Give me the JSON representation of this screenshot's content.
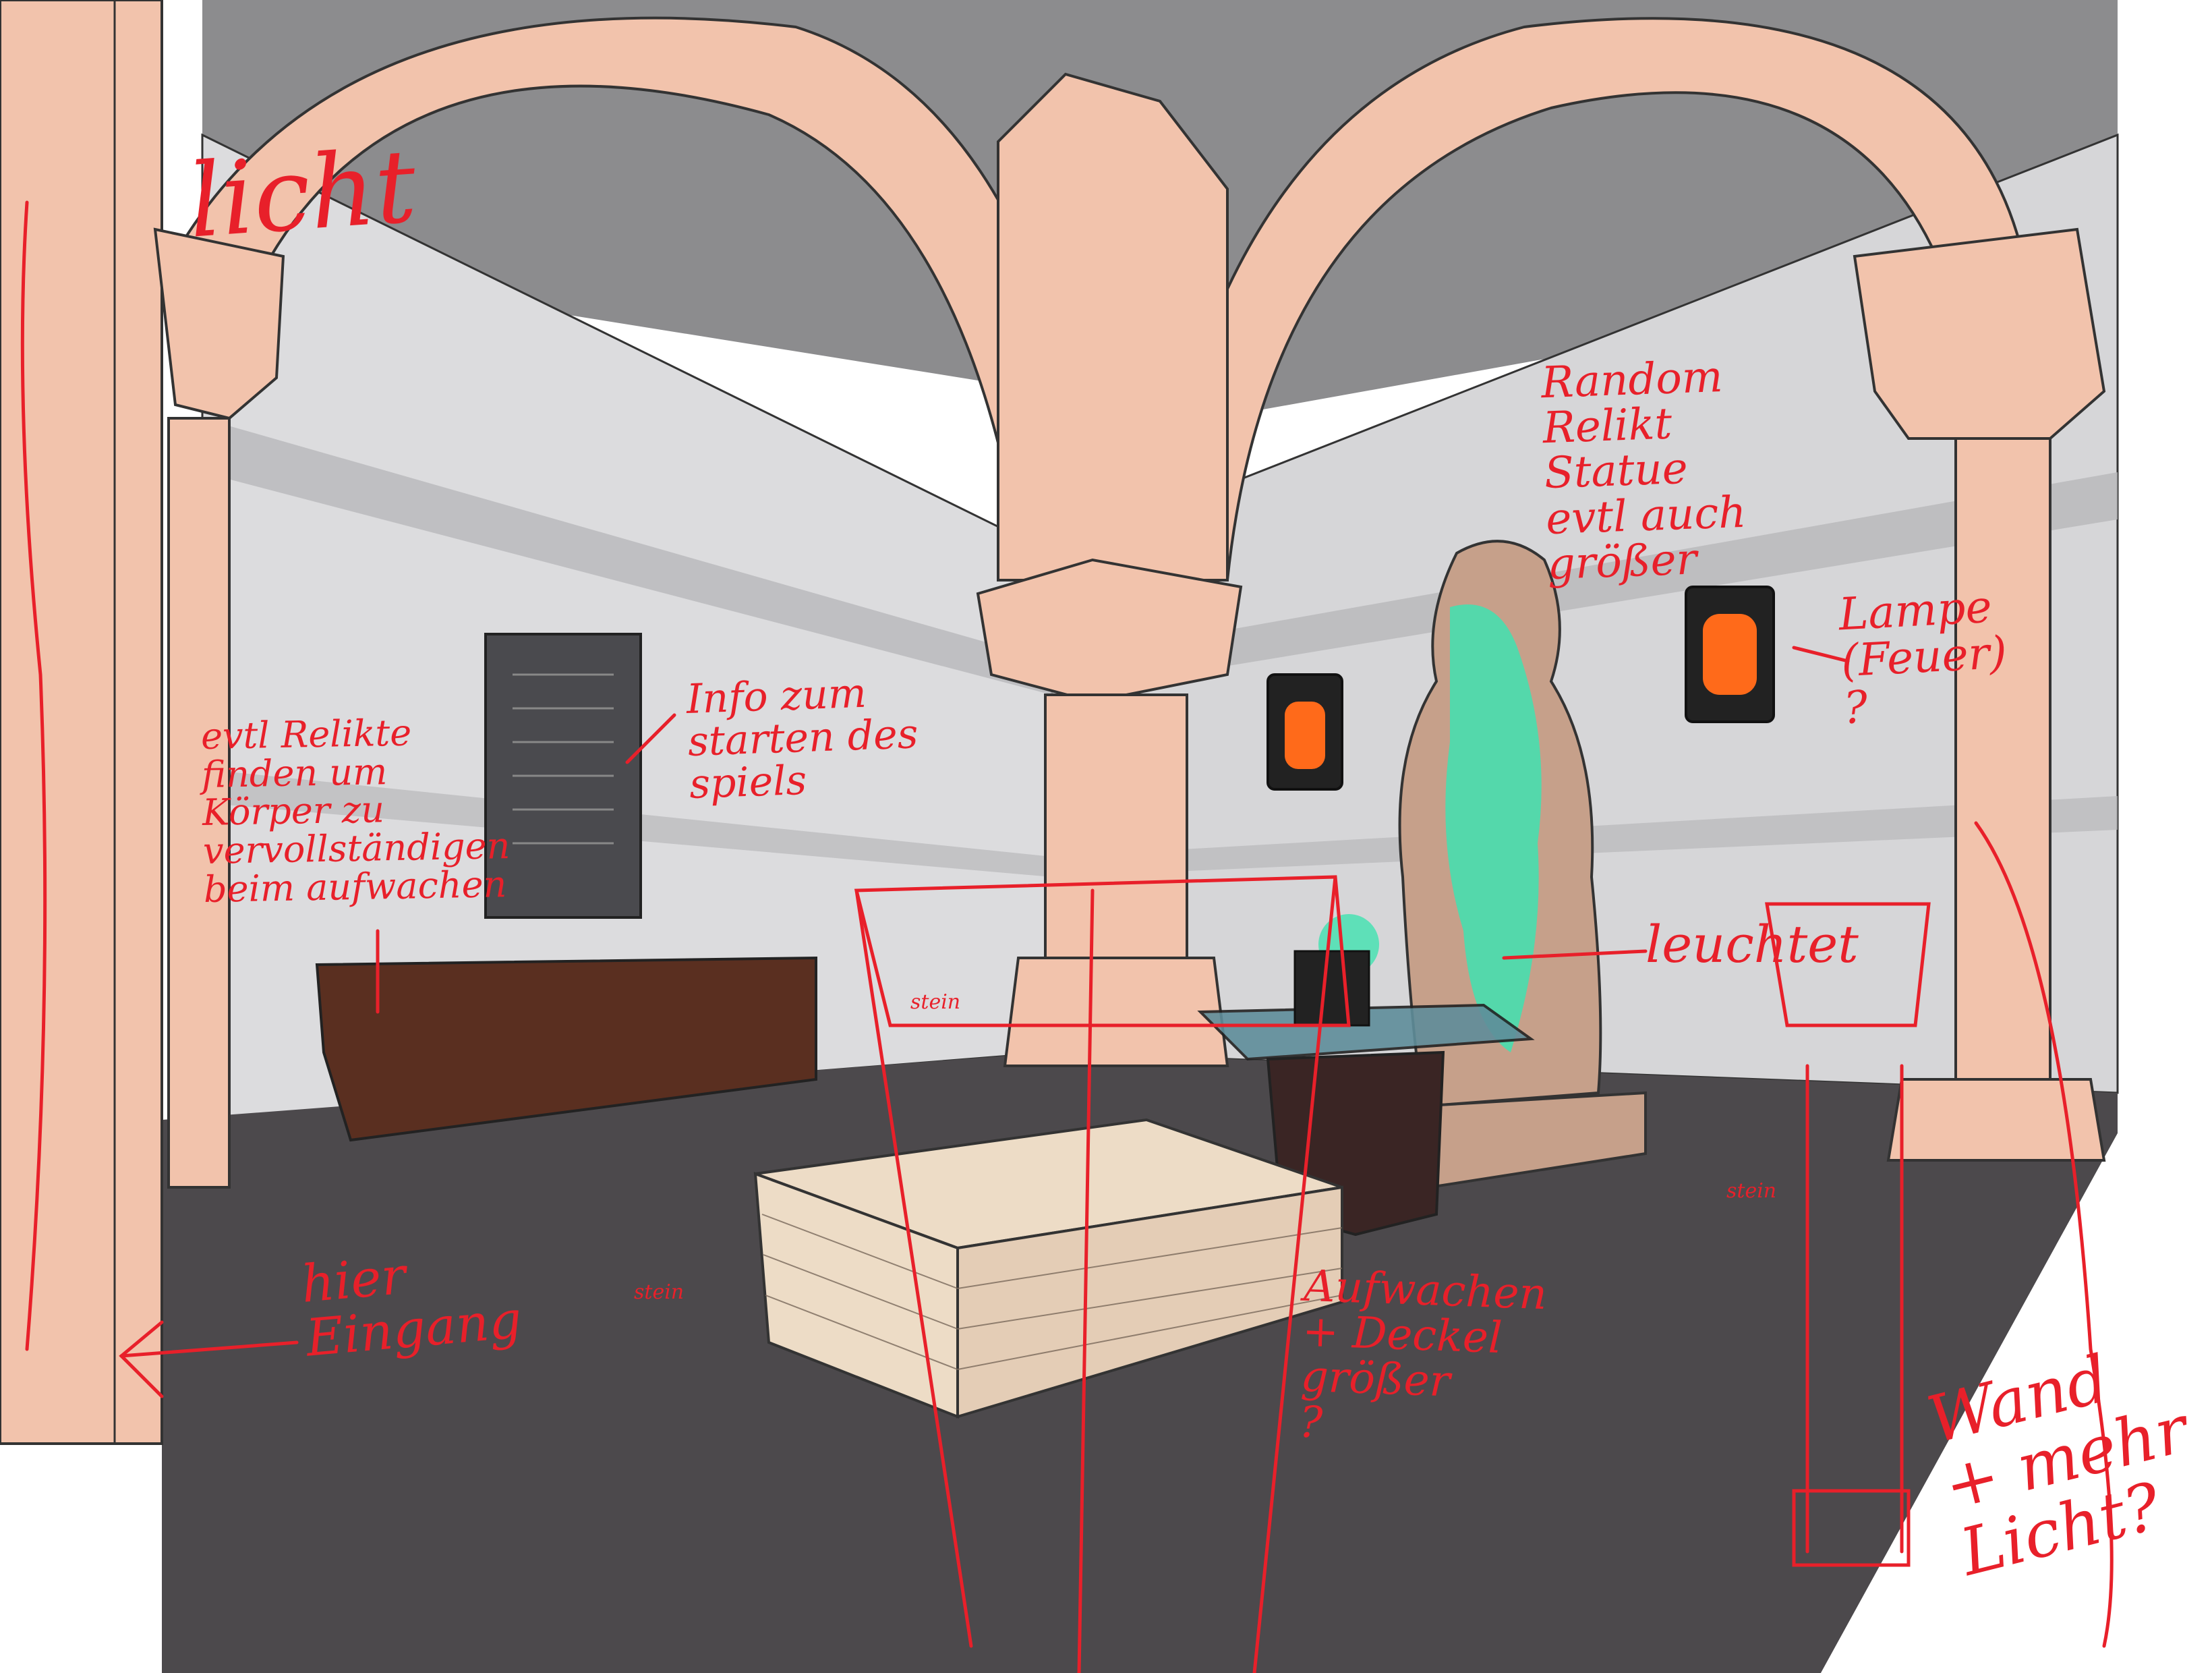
{
  "notes": {
    "licht": "licht",
    "info": [
      "Info zum",
      "starten des",
      "spiels"
    ],
    "relikte": [
      "evtl Relikte",
      "finden um",
      "Körper zu",
      "vervollständigen",
      "beim aufwachen"
    ],
    "random": [
      "Random",
      "Relikt",
      "Statue",
      "evtl auch",
      "größer"
    ],
    "lampe": [
      "Lampe",
      "(Feuer)",
      "?"
    ],
    "leuchtet": "leuchtet",
    "eingang": [
      "hier",
      "Eingang"
    ],
    "aufwachen": [
      "Aufwachen",
      "+ Deckel",
      "größer",
      "?"
    ],
    "stein": "stein",
    "wand": [
      "Wand",
      "+ mehr",
      "Licht?"
    ]
  },
  "colors": {
    "sketch": "#e8202a",
    "stone": "#f2c3ac",
    "wall": "#dcdcde",
    "floor": "#4c494c",
    "statue": "#c6a08a",
    "glow": "#40e2b0",
    "fire": "#ff6a1a",
    "wood": "#5a2f20"
  }
}
